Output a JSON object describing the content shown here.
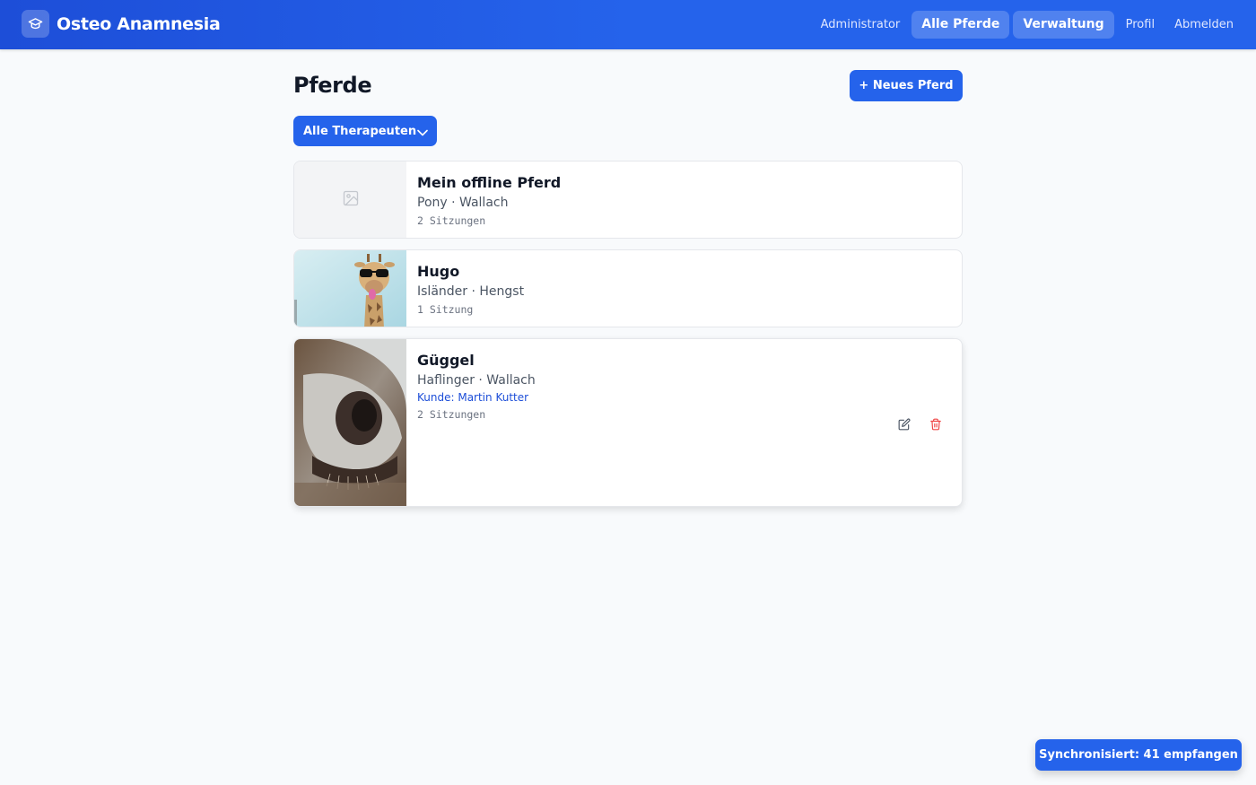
{
  "header": {
    "app_name": "Osteo Anamnesia",
    "logo_icon": "graduation-cap-icon",
    "nav": {
      "admin": "Administrator",
      "all_horses": "Alle Pferde",
      "management": "Verwaltung",
      "profile": "Profil",
      "logout": "Abmelden"
    }
  },
  "main": {
    "title": "Pferde",
    "new_button": "+ Neues Pferd",
    "filter_label": "Alle Therapeuten"
  },
  "horses": [
    {
      "name": "Mein offline Pferd",
      "meta": "Pony · Wallach",
      "sessions": "2 Sitzungen",
      "image": "image-placeholder-icon"
    },
    {
      "name": "Hugo",
      "meta": "Isländer · Hengst",
      "sessions": "1 Sitzung",
      "image": "giraffe-with-sunglasses-photo"
    },
    {
      "name": "Güggel",
      "meta": "Haflinger · Wallach",
      "customer": "Kunde: Martin Kutter",
      "sessions": "2 Sitzungen",
      "image": "horse-muzzle-photo"
    }
  ],
  "toast": {
    "message": "Synchronisiert: 41 empfangen"
  },
  "colors": {
    "primary": "#2563eb",
    "header": "#1d4ed8",
    "background": "#f8fafc",
    "delete": "#ef4444",
    "customer_link": "#1d4ed8"
  }
}
